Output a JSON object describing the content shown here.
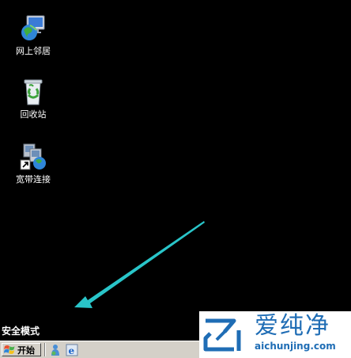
{
  "desktop": {
    "icons": [
      {
        "label": "网上邻居",
        "icon": "network-places-icon"
      },
      {
        "label": "回收站",
        "icon": "recycle-bin-icon"
      },
      {
        "label": "宽带连接",
        "icon": "broadband-connection-icon"
      }
    ],
    "safe_mode_label": "安全模式"
  },
  "taskbar": {
    "start_label": "开始",
    "quick_launch": [
      "messenger-icon",
      "internet-explorer-icon"
    ]
  },
  "watermark": {
    "brand_cn": "爱纯净",
    "url": "aichunjing.com"
  },
  "colors": {
    "desktop_bg": "#000000",
    "taskbar_bg": "#d4d0c8",
    "annotation_arrow": "#29c5c9",
    "watermark_blue": "#1f6db5"
  }
}
